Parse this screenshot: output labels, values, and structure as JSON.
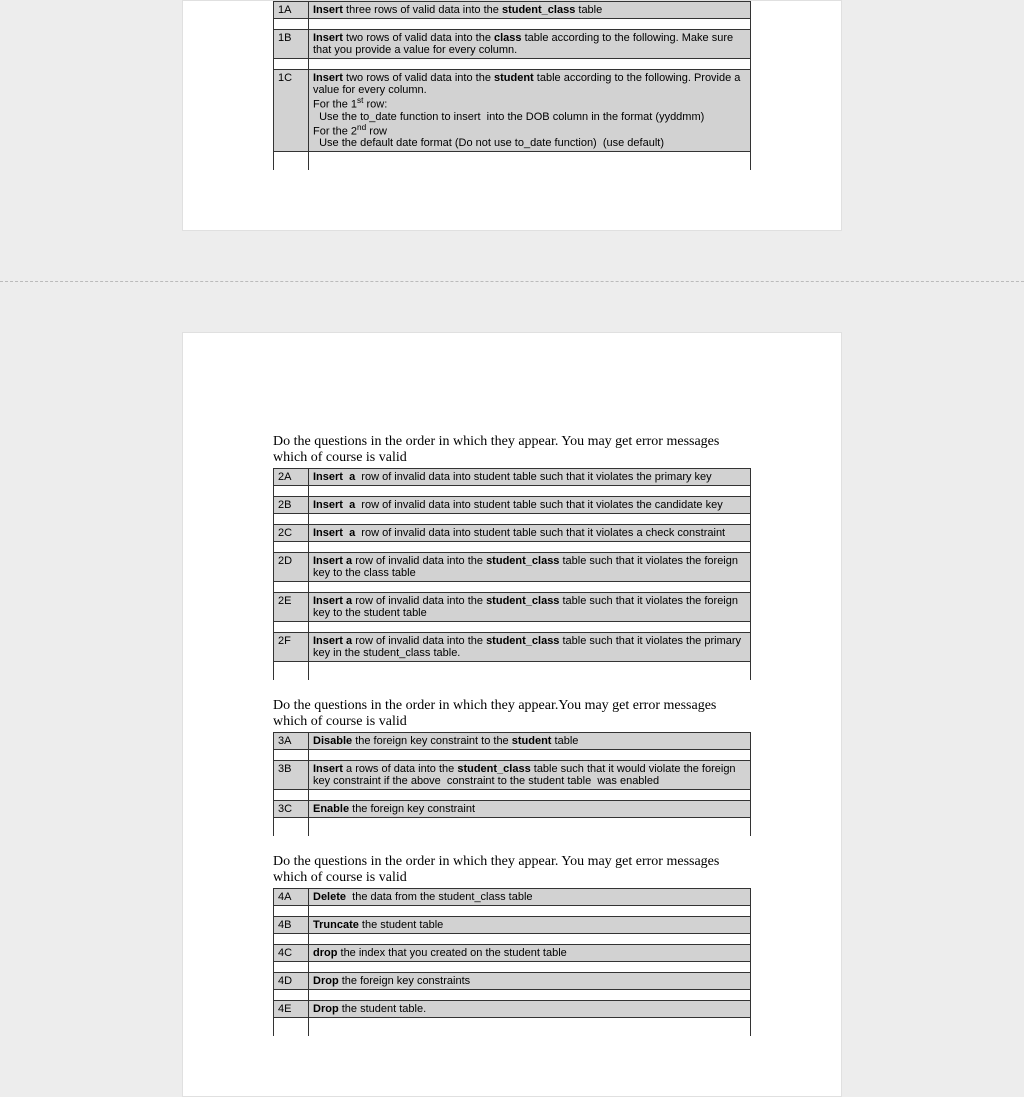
{
  "section1": {
    "rows": [
      {
        "code": "1A",
        "html": "<b>Insert</b> three rows of valid data into the <b>student_class</b> table"
      },
      {
        "code": "1B",
        "html": "<b>Insert</b> two rows of valid data into the <b>class</b> table according to the following. Make sure that you provide a value for every column."
      },
      {
        "code": "1C",
        "html": "<b>Insert</b> two rows of valid data into the <b>student</b> table according to the following. Provide a value for every column.<br>For the 1<sup>st</sup> row:<br>&nbsp;&nbsp;Use the to_date function to insert &nbsp;into the DOB column in the format (yyddmm)<br>For the 2<sup>nd</sup> row<br>&nbsp;&nbsp;Use the default date format (Do not use to_date function) &nbsp;(use default)"
      }
    ],
    "emptyTail": true
  },
  "section2": {
    "intro": "Do the questions in the order in which they appear. You may get error messages which of course is valid",
    "rows": [
      {
        "code": "2A",
        "html": "<b>Insert &nbsp;a</b>&nbsp; row of invalid data into student table such that it violates the primary key"
      },
      {
        "code": "2B",
        "html": "<b>Insert &nbsp;a</b>&nbsp; row of invalid data into student table such that it violates the candidate key"
      },
      {
        "code": "2C",
        "html": "<b>Insert &nbsp;a</b>&nbsp; row of invalid data into student table such that it violates a check constraint"
      },
      {
        "code": "2D",
        "html": "<b>Insert a</b> row of invalid data into the <b>student_class</b> table such that it violates the foreign key to the class table"
      },
      {
        "code": "2E",
        "html": "<b>Insert a</b> row of invalid data into the <b>student_class</b> table such that it violates the foreign key to the student table"
      },
      {
        "code": "2F",
        "html": "<b>Insert a</b> row of invalid data into the <b>student_class</b> table such that it violates the primary key in the student_class table."
      }
    ],
    "emptyTail": true
  },
  "section3": {
    "intro": "Do the questions in the order in which they appear.You may get error messages which of course is valid",
    "rows": [
      {
        "code": "3A",
        "html": "<b>Disable</b> the foreign key constraint to the <b>student</b> table"
      },
      {
        "code": "3B",
        "html": "<b>Insert</b> a rows of data into the <b>student_class</b> table such that it would violate the foreign key constraint if the above &nbsp;constraint to the student table &nbsp;was enabled"
      },
      {
        "code": "3C",
        "html": "<b>Enable</b> the foreign key constraint"
      }
    ],
    "emptyTail": true
  },
  "section4": {
    "intro": "Do the questions in the order in which they appear.  You may get error messages which of course is valid",
    "rows": [
      {
        "code": "4A",
        "html": "<b>Delete</b> &nbsp;the data from the student_class table"
      },
      {
        "code": "4B",
        "html": "<b>Truncate</b> the student table"
      },
      {
        "code": "4C",
        "html": "<b>drop</b> the index that you created on the student table"
      },
      {
        "code": "4D",
        "html": "<b>Drop</b> the foreign key constraints"
      },
      {
        "code": "4E",
        "html": "<b>Drop</b> the student table."
      }
    ],
    "emptyTail": true
  }
}
